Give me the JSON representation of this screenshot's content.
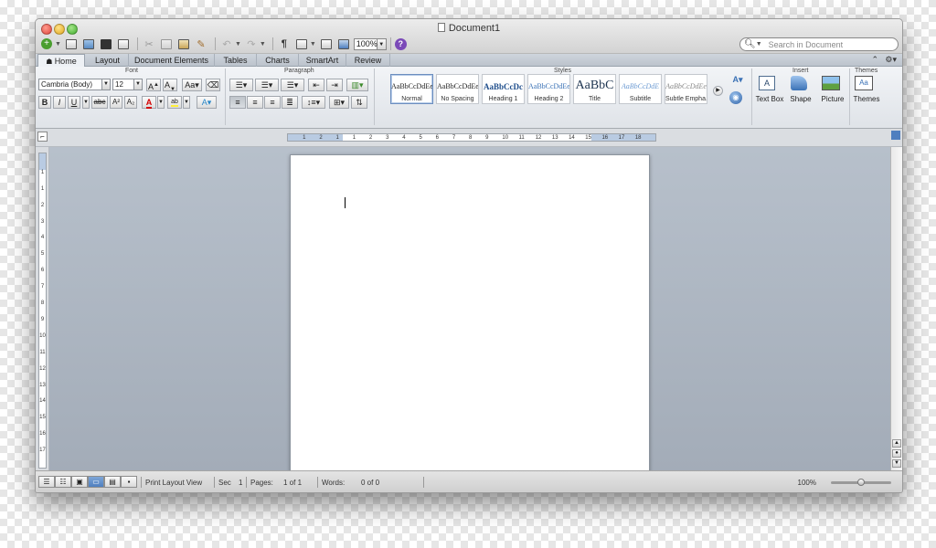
{
  "window": {
    "title": "Document1"
  },
  "toolbar": {
    "zoom_value": "100%",
    "search_placeholder": "Search in Document"
  },
  "tabs": [
    {
      "label": "Home",
      "active": true
    },
    {
      "label": "Layout"
    },
    {
      "label": "Document Elements"
    },
    {
      "label": "Tables"
    },
    {
      "label": "Charts"
    },
    {
      "label": "SmartArt"
    },
    {
      "label": "Review"
    }
  ],
  "ribbon": {
    "groups": {
      "font": "Font",
      "paragraph": "Paragraph",
      "styles": "Styles",
      "insert": "Insert",
      "themes": "Themes"
    },
    "font_name": "Cambria (Body)",
    "font_size": "12",
    "styles": [
      {
        "sample": "AaBbCcDdEe",
        "name": "Normal"
      },
      {
        "sample": "AaBbCcDdEe",
        "name": "No Spacing"
      },
      {
        "sample": "AaBbCcDc",
        "name": "Heading 1"
      },
      {
        "sample": "AaBbCcDdEe",
        "name": "Heading 2"
      },
      {
        "sample": "AaBbC",
        "name": "Title"
      },
      {
        "sample": "AaBbCcDdE",
        "name": "Subtitle"
      },
      {
        "sample": "AaBbCcDdEe",
        "name": "Subtle Empha..."
      }
    ],
    "insert": [
      {
        "label": "Text Box",
        "icon": "text-box-icon"
      },
      {
        "label": "Shape",
        "icon": "shape-icon"
      },
      {
        "label": "Picture",
        "icon": "picture-icon"
      }
    ],
    "themes_label": "Themes"
  },
  "ruler": {
    "ticks": [
      "1",
      "2",
      "1",
      "1",
      "2",
      "3",
      "4",
      "5",
      "6",
      "7",
      "8",
      "9",
      "10",
      "11",
      "12",
      "13",
      "14",
      "15",
      "16",
      "17",
      "18"
    ]
  },
  "vruler": {
    "ticks": [
      "1",
      "1",
      "2",
      "3",
      "4",
      "5",
      "6",
      "7",
      "8",
      "9",
      "10",
      "11",
      "12",
      "13",
      "14",
      "15",
      "16",
      "17"
    ]
  },
  "status": {
    "view": "Print Layout View",
    "sec_label": "Sec",
    "sec_value": "1",
    "pages_label": "Pages:",
    "pages_value": "1 of 1",
    "words_label": "Words:",
    "words_value": "0 of 0",
    "zoom": "100%"
  },
  "colors": {
    "accent": "#4f7fbf",
    "doc_background": "#a9b2bd",
    "font_color": "#d40000",
    "highlight": "#ffef3a"
  }
}
